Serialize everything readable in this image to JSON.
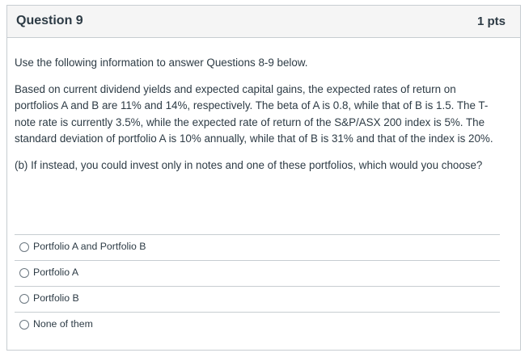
{
  "question": {
    "title": "Question 9",
    "points": "1 pts"
  },
  "body": {
    "intro": "Use the following information to answer Questions 8-9 below.",
    "paragraph": "Based on current dividend yields and expected capital gains, the expected rates of return on portfolios A and B are 11% and 14%, respectively. The beta of A is 0.8, while that of B is 1.5. The T-note rate is currently 3.5%, while the expected rate of return of the S&P/ASX 200 index is 5%. The standard deviation of portfolio A is 10% annually, while that of B is 31% and that of the index is 20%.",
    "prompt": "(b) If instead, you could invest only in notes and one of these portfolios, which would you choose?"
  },
  "answers": [
    {
      "label": "Portfolio A and Portfolio B"
    },
    {
      "label": "Portfolio A"
    },
    {
      "label": "Portfolio B"
    },
    {
      "label": "None of them"
    }
  ]
}
